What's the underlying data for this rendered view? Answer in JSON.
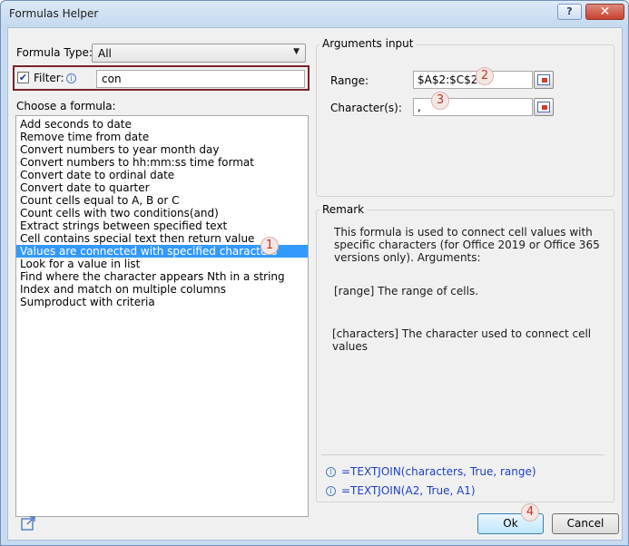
{
  "window": {
    "title": "Formulas Helper",
    "help_label": "?",
    "close_label": "✕"
  },
  "left": {
    "formula_type_label": "Formula Type:",
    "formula_type_value": "All",
    "filter_label": "Filter:",
    "filter_value": "con",
    "choose_label": "Choose a formula:",
    "formulas": [
      "Add seconds to date",
      "Remove time from date",
      "Convert numbers to year month day",
      "Convert numbers to hh:mm:ss time format",
      "Convert date to ordinal date",
      "Convert date to quarter",
      "Count cells equal to A, B or C",
      "Count cells with two conditions(and)",
      "Extract strings between specified text",
      "Cell contains special text then return value",
      "Values are connected with specified characters",
      "Look for a value in list",
      "Find where the character appears Nth in a string",
      "Index and match on multiple columns",
      "Sumproduct with criteria"
    ],
    "selected_index": 10
  },
  "arguments": {
    "title": "Arguments input",
    "range_label": "Range:",
    "range_value": "$A$2:$C$2",
    "chars_label": "Character(s):",
    "chars_value": ","
  },
  "remark": {
    "title": "Remark",
    "line1": "This formula is used to connect cell values with",
    "line2": "specific characters (for Office 2019 or Office 365",
    "line3": "versions only). Arguments:",
    "range_desc": "[range] The range of cells.",
    "chars_desc1": "[characters] The character used to connect cell",
    "chars_desc2": "values",
    "formula1": "=TEXTJOIN(characters, True, range)",
    "formula2": "=TEXTJOIN(A2, True, A1)"
  },
  "buttons": {
    "ok": "Ok",
    "cancel": "Cancel"
  },
  "badges": [
    "1",
    "2",
    "3",
    "4"
  ],
  "colors": {
    "selection": "#3399ff",
    "formula_text": "#1d3fc6",
    "badge_text": "#c0362c",
    "filter_border": "#7a2323"
  }
}
